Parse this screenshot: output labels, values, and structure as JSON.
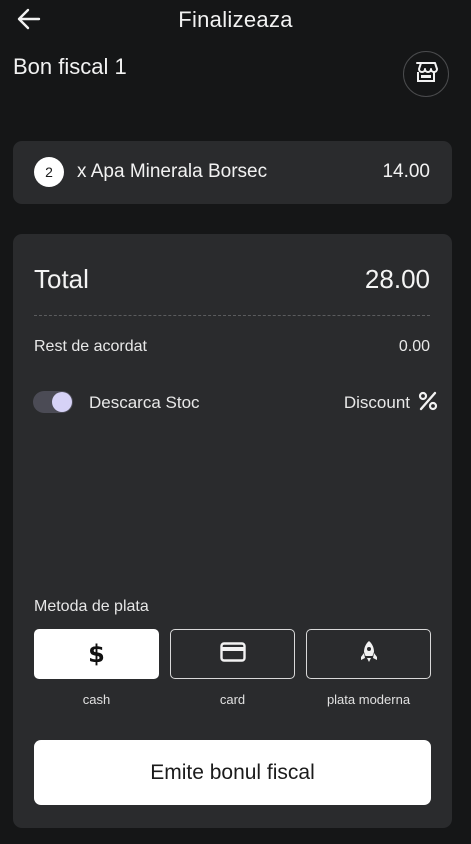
{
  "header": {
    "title": "Finalizeaza",
    "back_icon": "arrow-left-icon"
  },
  "document": {
    "title": "Bon fiscal 1",
    "store_icon": "store-icon"
  },
  "items": [
    {
      "qty": "2",
      "name": "x Apa Minerala Borsec",
      "price": "14.00"
    }
  ],
  "summary": {
    "total_label": "Total",
    "total_value": "28.00",
    "rest_label": "Rest de acordat",
    "rest_value": "0.00",
    "stock_toggle_label": "Descarca Stoc",
    "stock_toggle_on": true,
    "discount_label": "Discount",
    "discount_icon": "percent-icon"
  },
  "payment": {
    "label": "Metoda de plata",
    "selected": "cash",
    "methods": [
      {
        "id": "cash",
        "label": "cash",
        "icon": "dollar-icon"
      },
      {
        "id": "card",
        "label": "card",
        "icon": "credit-card-icon"
      },
      {
        "id": "modern",
        "label": "plata moderna",
        "icon": "rocket-icon"
      }
    ]
  },
  "action": {
    "emit_label": "Emite bonul fiscal"
  },
  "colors": {
    "background": "#151617",
    "card": "#2a2b2d",
    "toggle_knob": "#d6d2f6",
    "button": "#ffffff"
  }
}
